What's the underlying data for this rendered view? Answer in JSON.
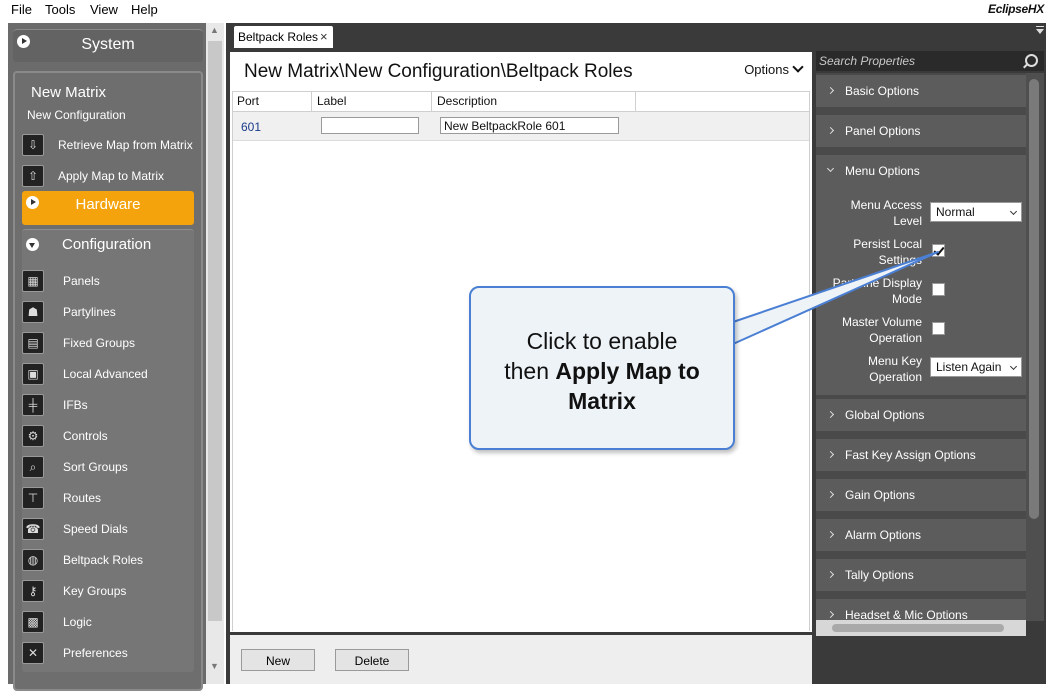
{
  "menubar": {
    "items": [
      "File",
      "Tools",
      "View",
      "Help"
    ],
    "logo": "EclipseHX"
  },
  "sidebar": {
    "system_label": "System",
    "matrix_title": "New Matrix",
    "config_title": "New Configuration",
    "actions": [
      {
        "label": "Retrieve Map from Matrix",
        "icon": "retrieve-map-icon"
      },
      {
        "label": "Apply Map to Matrix",
        "icon": "apply-map-icon"
      }
    ],
    "hardware_label": "Hardware",
    "configuration_label": "Configuration",
    "items": [
      {
        "label": "Panels",
        "icon": "panels-icon"
      },
      {
        "label": "Partylines",
        "icon": "partylines-icon"
      },
      {
        "label": "Fixed Groups",
        "icon": "fixed-groups-icon"
      },
      {
        "label": "Local Advanced",
        "icon": "local-advanced-icon"
      },
      {
        "label": "IFBs",
        "icon": "ifbs-icon"
      },
      {
        "label": "Controls",
        "icon": "controls-icon"
      },
      {
        "label": "Sort Groups",
        "icon": "sort-groups-icon"
      },
      {
        "label": "Routes",
        "icon": "routes-icon"
      },
      {
        "label": "Speed Dials",
        "icon": "speed-dials-icon"
      },
      {
        "label": "Beltpack Roles",
        "icon": "beltpack-roles-icon"
      },
      {
        "label": "Key Groups",
        "icon": "key-groups-icon"
      },
      {
        "label": "Logic",
        "icon": "logic-icon"
      },
      {
        "label": "Preferences",
        "icon": "preferences-icon"
      }
    ]
  },
  "tab": {
    "label": "Beltpack Roles",
    "close": "×"
  },
  "main": {
    "title": "New Matrix\\New Configuration\\Beltpack Roles",
    "options_label": "Options",
    "columns": [
      "Port",
      "Label",
      "Description"
    ],
    "rows": [
      {
        "port": "601",
        "label": "",
        "description": "New BeltpackRole 601"
      }
    ],
    "new_button": "New",
    "delete_button": "Delete"
  },
  "properties": {
    "search_placeholder": "Search Properties",
    "sections_before": [
      "Basic Options",
      "Panel Options"
    ],
    "menu_options": {
      "title": "Menu Options",
      "menu_access_level": {
        "label1": "Menu Access",
        "label2": "Level",
        "value": "Normal"
      },
      "persist_local_settings": {
        "label1": "Persist Local",
        "label2": "Settings",
        "checked": true
      },
      "partyline_display_mode": {
        "label1": "Partyline Display",
        "label2": "Mode",
        "checked": false
      },
      "master_volume_operation": {
        "label1": "Master Volume",
        "label2": "Operation",
        "checked": false
      },
      "menu_key_operation": {
        "label1": "Menu Key",
        "label2": "Operation",
        "value": "Listen Again"
      }
    },
    "sections_after": [
      "Global Options",
      "Fast Key Assign Options",
      "Gain Options",
      "Alarm Options",
      "Tally Options",
      "Headset & Mic Options"
    ]
  },
  "callout": {
    "line1": "Click to enable",
    "line2_prefix": "then ",
    "line2_bold": "Apply Map to",
    "line3_bold": "Matrix",
    "border_color": "#4a7fd4"
  },
  "colors": {
    "accent": "#f5a30c",
    "sidebar_bg": "#6b6b6b",
    "panel_dark": "#3a3a3a"
  }
}
